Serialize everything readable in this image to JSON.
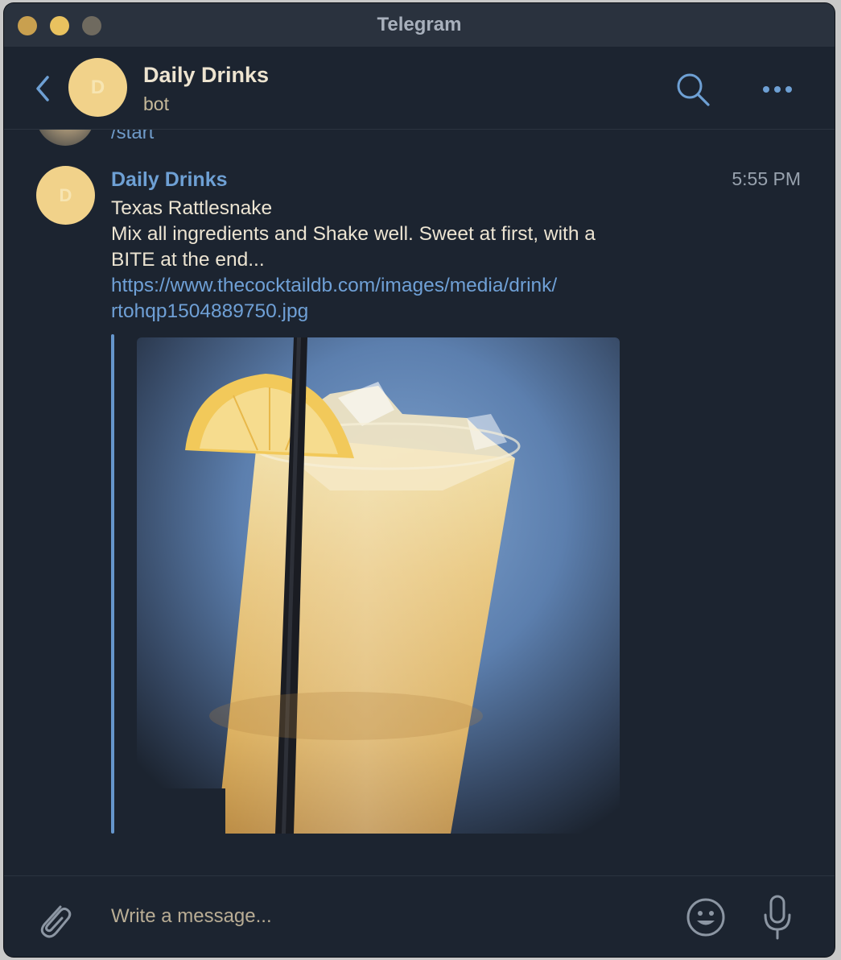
{
  "window": {
    "title": "Telegram"
  },
  "header": {
    "chat_name": "Daily Drinks",
    "chat_status": "bot",
    "avatar_initial": "D"
  },
  "messages": {
    "previous": {
      "text": "/start"
    },
    "current": {
      "sender": "Daily Drinks",
      "avatar_initial": "D",
      "time": "5:55 PM",
      "line1": "Texas Rattlesnake",
      "line2": "Mix all ingredients and Shake well. Sweet at first, with a",
      "line3": "BITE at the end...",
      "link_line1": "https://www.thecocktaildb.com/images/media/drink/",
      "link_line2": "rtohqp1504889750.jpg"
    }
  },
  "composer": {
    "placeholder": "Write a message..."
  },
  "colors": {
    "background": "#1c2430",
    "accent": "#6ea0d4",
    "avatar": "#f1d28a",
    "text": "#ece4d2"
  },
  "icons": [
    "back-icon",
    "search-icon",
    "more-icon",
    "attach-icon",
    "emoji-icon",
    "mic-icon"
  ]
}
